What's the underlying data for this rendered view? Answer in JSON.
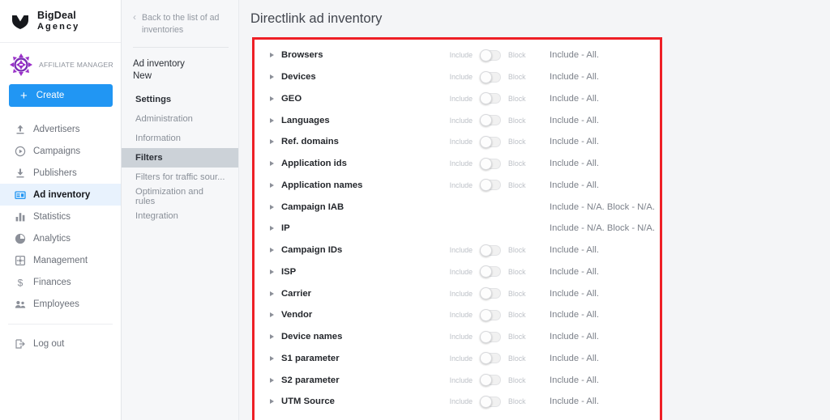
{
  "brand": {
    "name": "BigDeal",
    "subtitle": "Agency",
    "logo_icon": "shield-chevron-logo"
  },
  "account": {
    "role": "AFFILIATE MANAGER",
    "badge_icon": "affiliate-badge-icon",
    "create_label": "Create",
    "create_icon": "plus-icon"
  },
  "sidebar": {
    "items": [
      {
        "label": "Advertisers",
        "icon": "upload-arrow-icon",
        "active": false
      },
      {
        "label": "Campaigns",
        "icon": "play-circle-icon",
        "active": false
      },
      {
        "label": "Publishers",
        "icon": "download-arrow-icon",
        "active": false
      },
      {
        "label": "Ad inventory",
        "icon": "card-icon",
        "active": true
      },
      {
        "label": "Statistics",
        "icon": "bar-chart-icon",
        "active": false
      },
      {
        "label": "Analytics",
        "icon": "pie-chart-icon",
        "active": false
      },
      {
        "label": "Management",
        "icon": "settings-square-icon",
        "active": false
      },
      {
        "label": "Finances",
        "icon": "dollar-icon",
        "active": false
      },
      {
        "label": "Employees",
        "icon": "people-icon",
        "active": false
      }
    ],
    "logout": {
      "label": "Log out",
      "icon": "logout-icon"
    }
  },
  "midpanel": {
    "back_link": "Back to the list of ad inventories",
    "back_icon": "chevron-left-icon",
    "inventory_title": "Ad inventory",
    "inventory_subtitle": "New",
    "items": [
      {
        "label": "Settings",
        "style": "head"
      },
      {
        "label": "Administration",
        "style": "plain"
      },
      {
        "label": "Information",
        "style": "plain"
      },
      {
        "label": "Filters",
        "style": "sel"
      },
      {
        "label": "Filters for traffic sour...",
        "style": "plain"
      },
      {
        "label": "Optimization and rules",
        "style": "plain"
      },
      {
        "label": "Integration",
        "style": "plain"
      }
    ]
  },
  "main": {
    "page_title": "Directlink ad inventory",
    "highlight_color": "#ee1f26",
    "accent_color": "#2196f3",
    "toggle_labels": {
      "include": "Include",
      "block": "Block"
    },
    "summary_all": "Include - All.",
    "summary_na": "Include - N/A. Block - N/A.",
    "filters": [
      {
        "label": "Browsers",
        "has_toggle": true,
        "summary": "Include - All."
      },
      {
        "label": "Devices",
        "has_toggle": true,
        "summary": "Include - All."
      },
      {
        "label": "GEO",
        "has_toggle": true,
        "summary": "Include - All."
      },
      {
        "label": "Languages",
        "has_toggle": true,
        "summary": "Include - All."
      },
      {
        "label": "Ref. domains",
        "has_toggle": true,
        "summary": "Include - All."
      },
      {
        "label": "Application ids",
        "has_toggle": true,
        "summary": "Include - All."
      },
      {
        "label": "Application names",
        "has_toggle": true,
        "summary": "Include - All."
      },
      {
        "label": "Campaign IAB",
        "has_toggle": false,
        "summary": "Include - N/A. Block - N/A."
      },
      {
        "label": "IP",
        "has_toggle": false,
        "summary": "Include - N/A. Block - N/A."
      },
      {
        "label": "Campaign IDs",
        "has_toggle": true,
        "summary": "Include - All."
      },
      {
        "label": "ISP",
        "has_toggle": true,
        "summary": "Include - All."
      },
      {
        "label": "Carrier",
        "has_toggle": true,
        "summary": "Include - All."
      },
      {
        "label": "Vendor",
        "has_toggle": true,
        "summary": "Include - All."
      },
      {
        "label": "Device names",
        "has_toggle": true,
        "summary": "Include - All."
      },
      {
        "label": "S1 parameter",
        "has_toggle": true,
        "summary": "Include - All."
      },
      {
        "label": "S2 parameter",
        "has_toggle": true,
        "summary": "Include - All."
      },
      {
        "label": "UTM Source",
        "has_toggle": true,
        "summary": "Include - All."
      }
    ]
  }
}
